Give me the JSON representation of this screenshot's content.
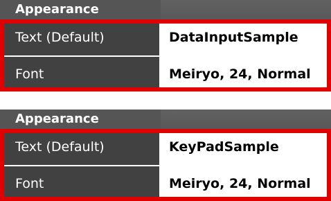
{
  "panels": [
    {
      "header": "Appearance",
      "rows": [
        {
          "label": "Text (Default)",
          "value": "DataInputSample"
        },
        {
          "label": "Font",
          "value": "Meiryo, 24, Normal"
        }
      ]
    },
    {
      "header": "Appearance",
      "rows": [
        {
          "label": "Text (Default)",
          "value": "KeyPadSample"
        },
        {
          "label": "Font",
          "value": "Meiryo, 24, Normal"
        }
      ]
    }
  ],
  "colors": {
    "header_bg": "#5a5a5a",
    "label_bg": "#414141",
    "highlight": "#e00000"
  }
}
